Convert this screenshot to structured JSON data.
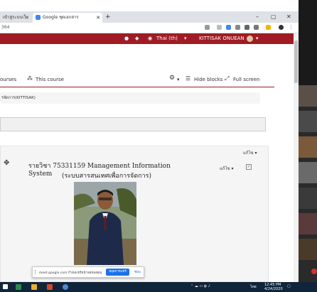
{
  "browser": {
    "tab1_title": "เข้าสู่ระบบเว็บไซต์การเรียน",
    "tab2_title": "Google ชุดเอกสาร",
    "new_tab": "+",
    "url": "364",
    "min": "–",
    "max": "▢",
    "close": "✕"
  },
  "topnav": {
    "bell": "🔔",
    "chat": "💬",
    "language": "Thai (th)",
    "user": "KITTISAK ONUEAN"
  },
  "coursenav": {
    "courses": "ourses",
    "this_course": "This course",
    "hide_blocks": "Hide blocks",
    "full_screen": "Full screen"
  },
  "breadcrumb": "รจัดการ(KITTISAK)",
  "section": {
    "edit_top": "แก้ไข ▾",
    "edit_right": "แก้ไข ▾",
    "title_line1": "รายวิชา 75331159 Management Information System",
    "title_line2": "(ระบบสารสนเทศเพื่อการจัดการ)"
  },
  "meet_bar": {
    "message": "meet.google.com กำลังแชร์หน้าจอของคุณ",
    "stop_label": "หยุดการแชร์",
    "hide_label": "ซ่อน"
  },
  "taskbar": {
    "lang": "ไทย",
    "time": "12:45 PM",
    "date": "4/24/2020"
  }
}
